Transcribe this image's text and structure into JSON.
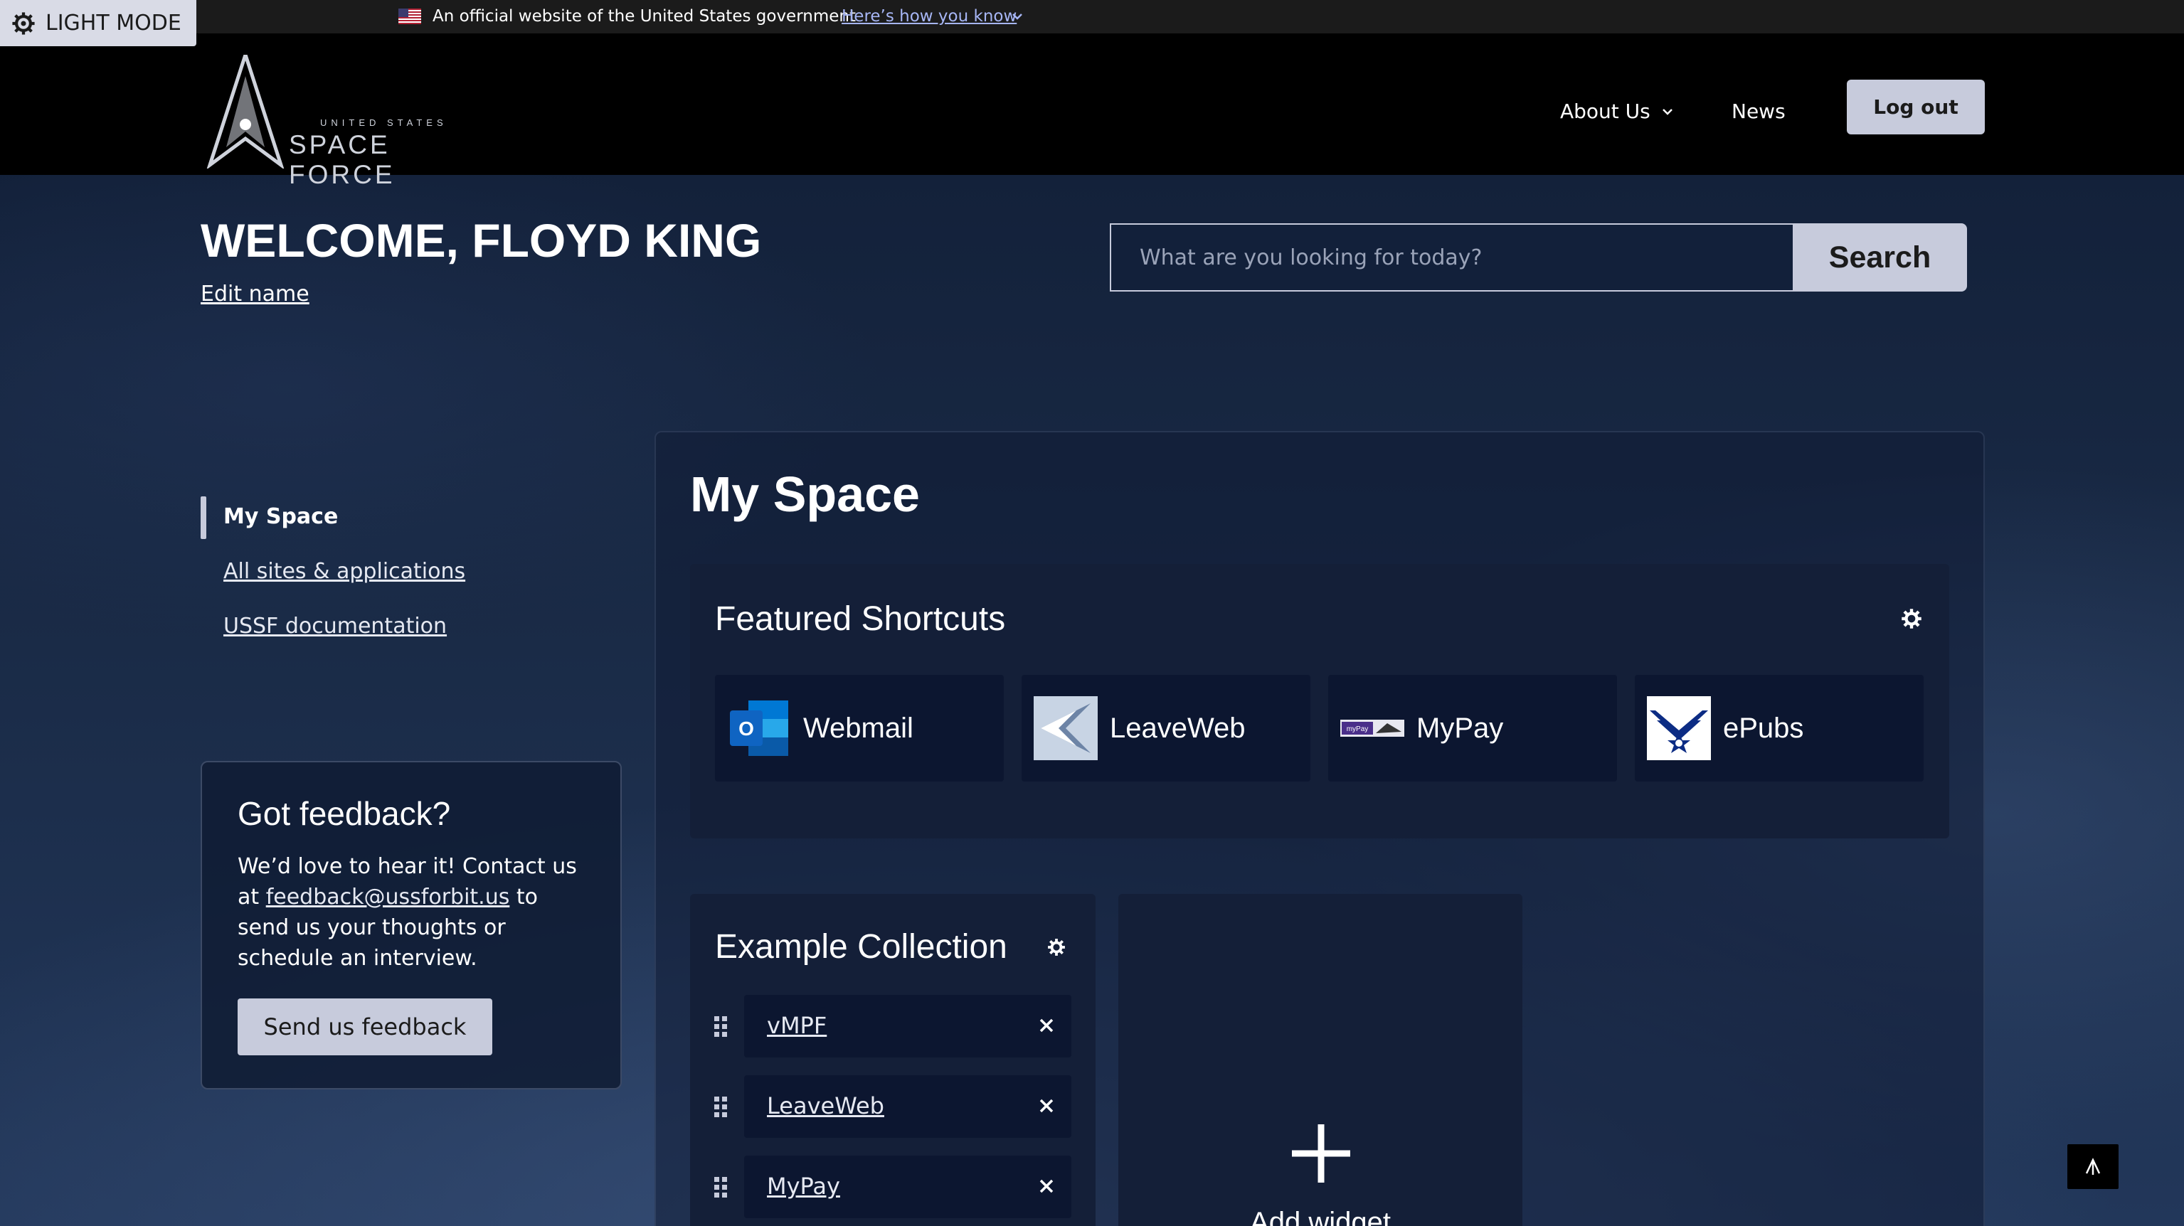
{
  "theme_toggle": {
    "label": "LIGHT MODE"
  },
  "gov_banner": {
    "text": "An official website of the United States government",
    "link": "Here’s how you know"
  },
  "header": {
    "logo_small": "UNITED STATES",
    "logo_big": "SPACE FORCE",
    "nav": {
      "about": "About Us",
      "news": "News"
    },
    "logout": "Log out"
  },
  "welcome": {
    "title": "WELCOME, FLOYD KING",
    "edit": "Edit name"
  },
  "search": {
    "placeholder": "What are you looking for today?",
    "button": "Search"
  },
  "sidebar": {
    "items": [
      {
        "label": "My Space",
        "active": true
      },
      {
        "label": "All sites & applications"
      },
      {
        "label": "USSF documentation"
      }
    ]
  },
  "feedback": {
    "title": "Got feedback?",
    "body_before": "We’d love to hear it! Contact us at ",
    "email": "feedback@ussforbit.us",
    "body_after": " to send us your thoughts or schedule an interview.",
    "button": "Send us feedback"
  },
  "myspace": {
    "title": "My Space",
    "featured": {
      "title": "Featured Shortcuts",
      "items": [
        {
          "label": "Webmail",
          "icon": "outlook-icon"
        },
        {
          "label": "LeaveWeb",
          "icon": "leaveweb-icon"
        },
        {
          "label": "MyPay",
          "icon": "mypay-icon"
        },
        {
          "label": "ePubs",
          "icon": "air-force-icon"
        }
      ]
    },
    "collection": {
      "title": "Example Collection",
      "items": [
        {
          "label": "vMPF"
        },
        {
          "label": "LeaveWeb"
        },
        {
          "label": "MyPay"
        }
      ]
    },
    "add_widget": {
      "label": "Add widget"
    }
  },
  "colors": {
    "accent": "#c7cbdc",
    "link": "#a7b6f5",
    "panel": "#141f38"
  }
}
